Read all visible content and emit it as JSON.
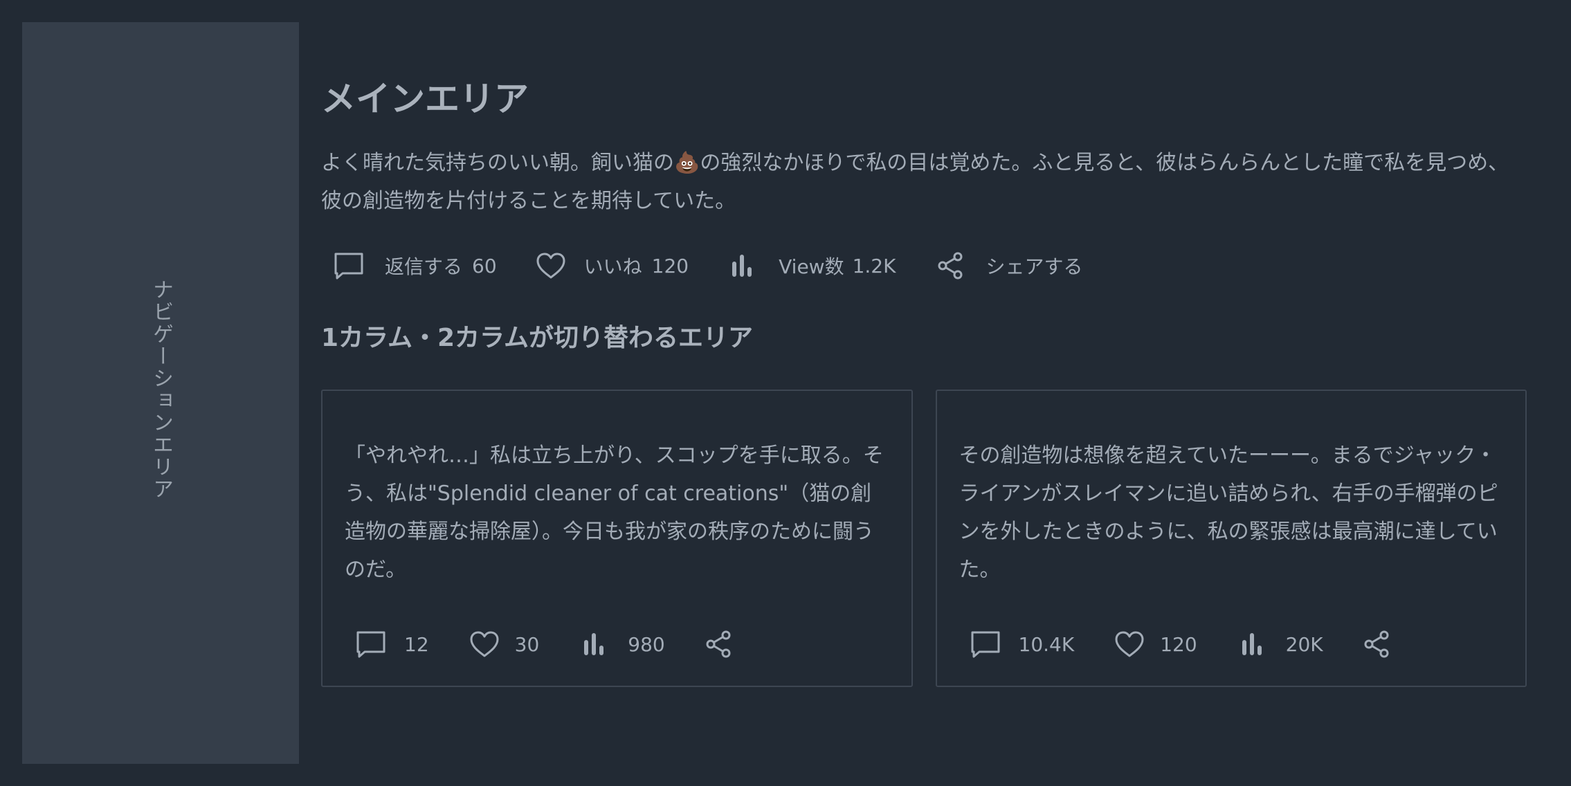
{
  "colors": {
    "background": "#222a34",
    "nav_background": "#353e4a",
    "text": "#a3acb7",
    "border": "#3d4652"
  },
  "nav": {
    "label": "ナビゲーションエリア"
  },
  "main": {
    "title": "メインエリア",
    "body": "よく晴れた気持ちのいい朝。飼い猫の💩の強烈なかほりで私の目は覚めた。ふと見ると、彼はらんらんとした瞳で私を見つめ、彼の創造物を片付けることを期待していた。",
    "actions": {
      "reply_label": "返信する",
      "reply_count": "60",
      "like_label": "いいね",
      "like_count": "120",
      "views_label": "View数",
      "views_count": "1.2K",
      "share_label": "シェアする"
    }
  },
  "section": {
    "title": "1カラム・2カラムが切り替わるエリア"
  },
  "cards": [
    {
      "body": "「やれやれ…」私は立ち上がり、スコップを手に取る。そう、私は\"Splendid cleaner of cat creations\"（猫の創造物の華麗な掃除屋）。今日も我が家の秩序のために闘うのだ。",
      "reply_count": "12",
      "like_count": "30",
      "views_count": "980"
    },
    {
      "body": "その創造物は想像を超えていたーーー。まるでジャック・ライアンがスレイマンに追い詰められ、右手の手榴弾のピンを外したときのように、私の緊張感は最高潮に達していた。",
      "reply_count": "10.4K",
      "like_count": "120",
      "views_count": "20K"
    }
  ],
  "icons": {
    "reply": "comment-icon",
    "like": "heart-icon",
    "views": "bar-chart-icon",
    "share": "share-icon"
  }
}
